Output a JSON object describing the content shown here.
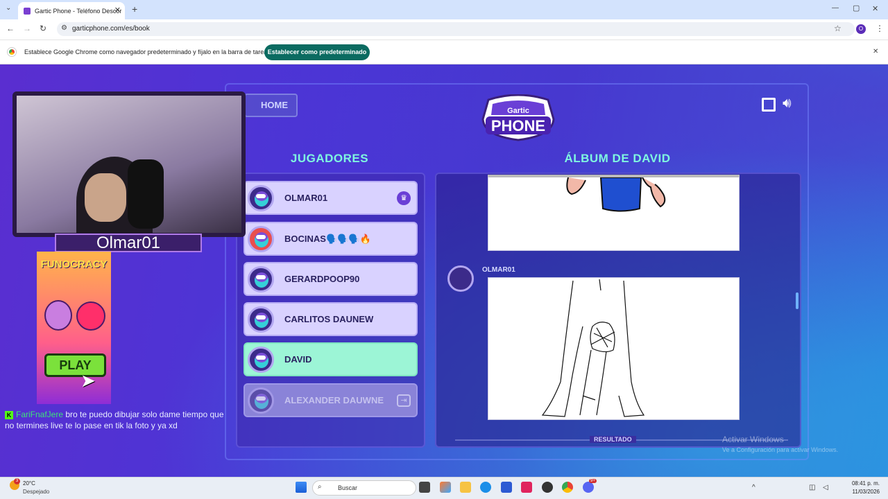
{
  "browser": {
    "tab_title": "Gartic Phone - Teléfono Descor",
    "tab_close": "✕",
    "new_tab": "+",
    "url": "garticphone.com/es/book",
    "profile_initial": "O",
    "win_min": "—",
    "win_max": "▢",
    "win_close": "✕"
  },
  "infobar": {
    "message": "Establece Google Chrome como navegador predeterminado y fíjalo en la barra de tareas",
    "button": "Establecer como predeterminado",
    "close": "✕"
  },
  "game": {
    "home_label": "HOME",
    "logo_top": "Gartic",
    "logo_main": "PHONE",
    "players_title": "JUGADORES",
    "album_title": "ÁLBUM DE DAVID",
    "players": [
      {
        "name": "OLMAR01",
        "state": "normal"
      },
      {
        "name": "BOCINAS🗣️🗣️🗣️🔥",
        "state": "normal"
      },
      {
        "name": "GERARDPOOP90",
        "state": "normal"
      },
      {
        "name": "CARLITOS DAUNEW",
        "state": "normal"
      },
      {
        "name": "DAVID",
        "state": "active"
      },
      {
        "name": "ALEXANDER DAUWNE",
        "state": "left"
      }
    ],
    "album_author": "OLMAR01",
    "result_label": "RESULTADO"
  },
  "stream": {
    "cam_name": "Olmar01",
    "ad_brand": "FUNOCRACY",
    "ad_play": "PLAY",
    "chat_user": "FariFnafJere",
    "chat_text": " bro te puedo dibujar solo dame tiempo que no termines live te lo pase en tik la foto y ya xd",
    "chat_badge": "K"
  },
  "watermark": {
    "line1": "Activar Windows",
    "line2": "Ve a Configuración para activar Windows."
  },
  "taskbar": {
    "weather_temp": "20°C",
    "weather_desc": "Despejado",
    "weather_badge": "3",
    "search_placeholder": "Buscar",
    "time": "08:41 p. m.",
    "date": "11/03/2026",
    "discord_badge": "9+"
  }
}
